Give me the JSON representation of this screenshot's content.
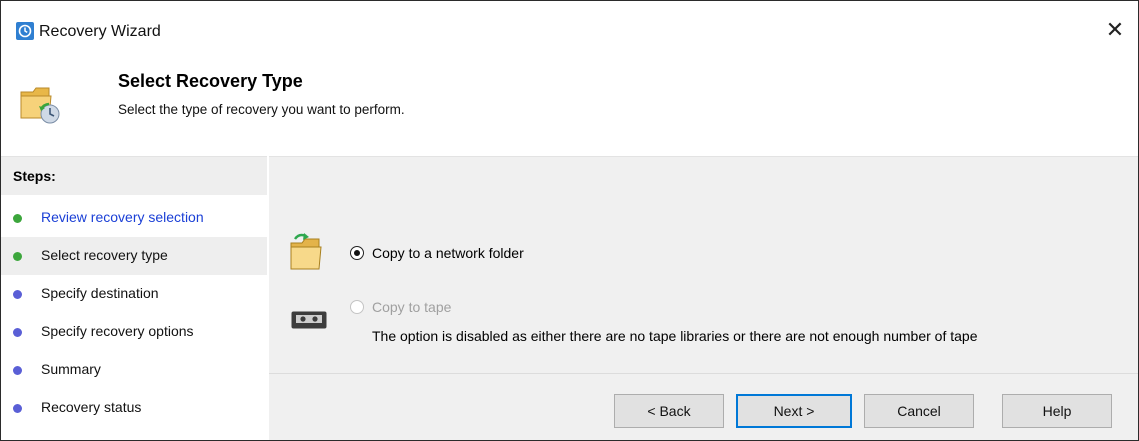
{
  "window": {
    "title": "Recovery Wizard",
    "app_icon": "backup-clock-icon",
    "close_icon": "close-icon",
    "close_glyph": "✕"
  },
  "header": {
    "title": "Select Recovery Type",
    "subtitle": "Select the type of recovery you want to perform.",
    "icon": "folder-recovery-icon"
  },
  "steps": {
    "heading": "Steps:",
    "items": [
      {
        "label": "Review recovery selection",
        "state": "completed",
        "dot_color": "#3ca63c",
        "link": true
      },
      {
        "label": "Select recovery type",
        "state": "current",
        "dot_color": "#3ca63c",
        "link": false
      },
      {
        "label": "Specify destination",
        "state": "pending",
        "dot_color": "#5a5fd6",
        "link": false
      },
      {
        "label": "Specify recovery options",
        "state": "pending",
        "dot_color": "#5a5fd6",
        "link": false
      },
      {
        "label": "Summary",
        "state": "pending",
        "dot_color": "#5a5fd6",
        "link": false
      },
      {
        "label": "Recovery status",
        "state": "pending",
        "dot_color": "#5a5fd6",
        "link": false
      }
    ]
  },
  "options": {
    "network": {
      "label": "Copy to a network folder",
      "selected": true,
      "enabled": true,
      "icon": "network-folder-icon"
    },
    "tape": {
      "label": "Copy to tape",
      "selected": false,
      "enabled": false,
      "icon": "tape-icon",
      "note": "The option is disabled as either there are no tape libraries or there are not enough number of tape"
    }
  },
  "buttons": {
    "back": "< Back",
    "next": "Next >",
    "cancel": "Cancel",
    "help": "Help"
  },
  "colors": {
    "link": "#1a3fd6",
    "disabled_text": "#a0a0a0",
    "panel_bg": "#f0f0f0",
    "accent": "#0078d7"
  }
}
